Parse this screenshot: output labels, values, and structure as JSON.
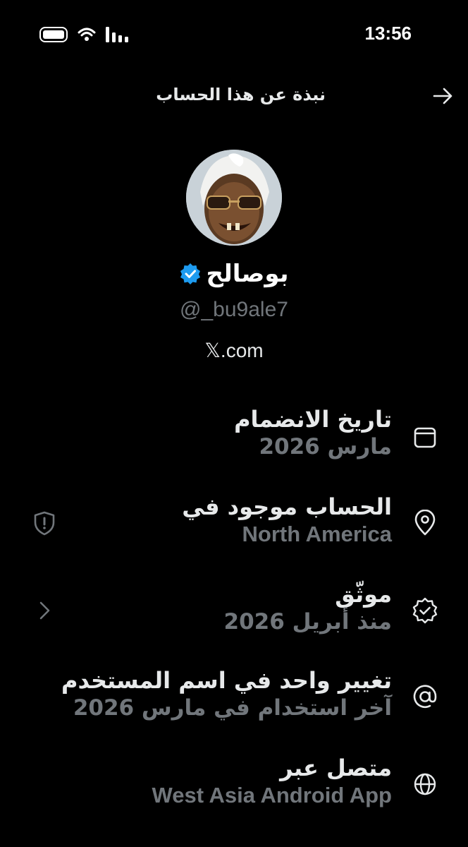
{
  "status_bar": {
    "time": "13:56"
  },
  "header": {
    "title": "نبذة عن هذا الحساب"
  },
  "profile": {
    "display_name": "بوصالح",
    "handle": "@_bu9ale7",
    "site": "𝕏.com"
  },
  "info": [
    {
      "label": "تاريخ الانضمام",
      "value": "مارس 2026",
      "icon": "calendar-icon"
    },
    {
      "label": "الحساب موجود في",
      "value": "North America",
      "icon": "location-pin-icon"
    },
    {
      "label": "موثّق",
      "value": "منذ أبريل 2026",
      "icon": "verified-badge-icon"
    },
    {
      "label": "تغيير واحد في اسم المستخدم",
      "value": "آخر استخدام في مارس 2026",
      "icon": "at-sign-icon"
    },
    {
      "label": "متصل عبر",
      "value": "West Asia Android App",
      "icon": "globe-icon"
    }
  ],
  "colors": {
    "background": "#000000",
    "text": "#e7e9ea",
    "secondary": "#71767b",
    "verified": "#1d9bf0"
  }
}
